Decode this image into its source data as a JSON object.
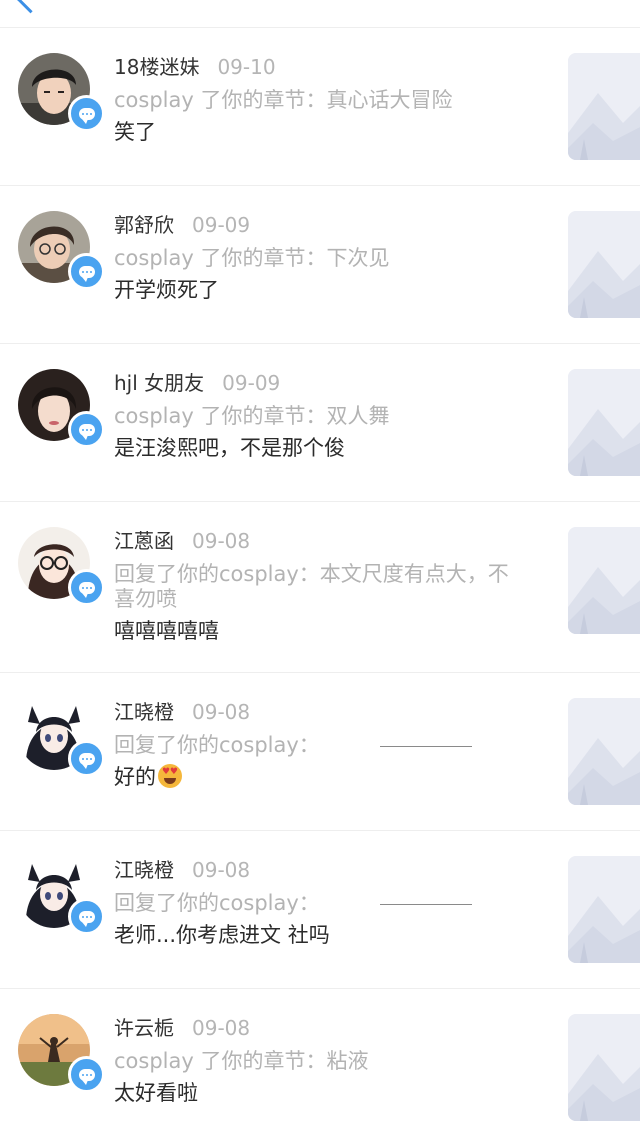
{
  "notifications": [
    {
      "name": "18楼迷妹",
      "date": "09-10",
      "description": "cosplay 了你的章节：真心话大冒险",
      "reply": "笑了"
    },
    {
      "name": "郭舒欣",
      "date": "09-09",
      "description": "cosplay 了你的章节：下次见",
      "reply": "开学烦死了"
    },
    {
      "name": "hjl 女朋友",
      "date": "09-09",
      "description": "cosplay 了你的章节：双人舞",
      "reply": "是汪浚熙吧，不是那个俊"
    },
    {
      "name": "江蒽函",
      "date": "09-08",
      "description": "回复了你的cosplay：本文尺度有点大，不喜勿喷",
      "reply": "嘻嘻嘻嘻嘻"
    },
    {
      "name": "江晓橙",
      "date": "09-08",
      "description": "回复了你的cosplay：",
      "reply": "好的"
    },
    {
      "name": "江晓橙",
      "date": "09-08",
      "description": "回复了你的cosplay：",
      "reply": "老师...你考虑进文  社吗"
    },
    {
      "name": "许云栀",
      "date": "09-08",
      "description": "cosplay 了你的章节：粘液",
      "reply": "太好看啦"
    }
  ],
  "icons": {
    "badge": "comment-bubble-icon",
    "thumbnail": "image-placeholder-icon",
    "reply_emoji": "heart-eyes-emoji-icon"
  },
  "colors": {
    "badge": "#4aa3f0",
    "secondary_text": "#b3b3b3",
    "primary_text": "#2b2b2b",
    "divider": "#eeeeee"
  }
}
